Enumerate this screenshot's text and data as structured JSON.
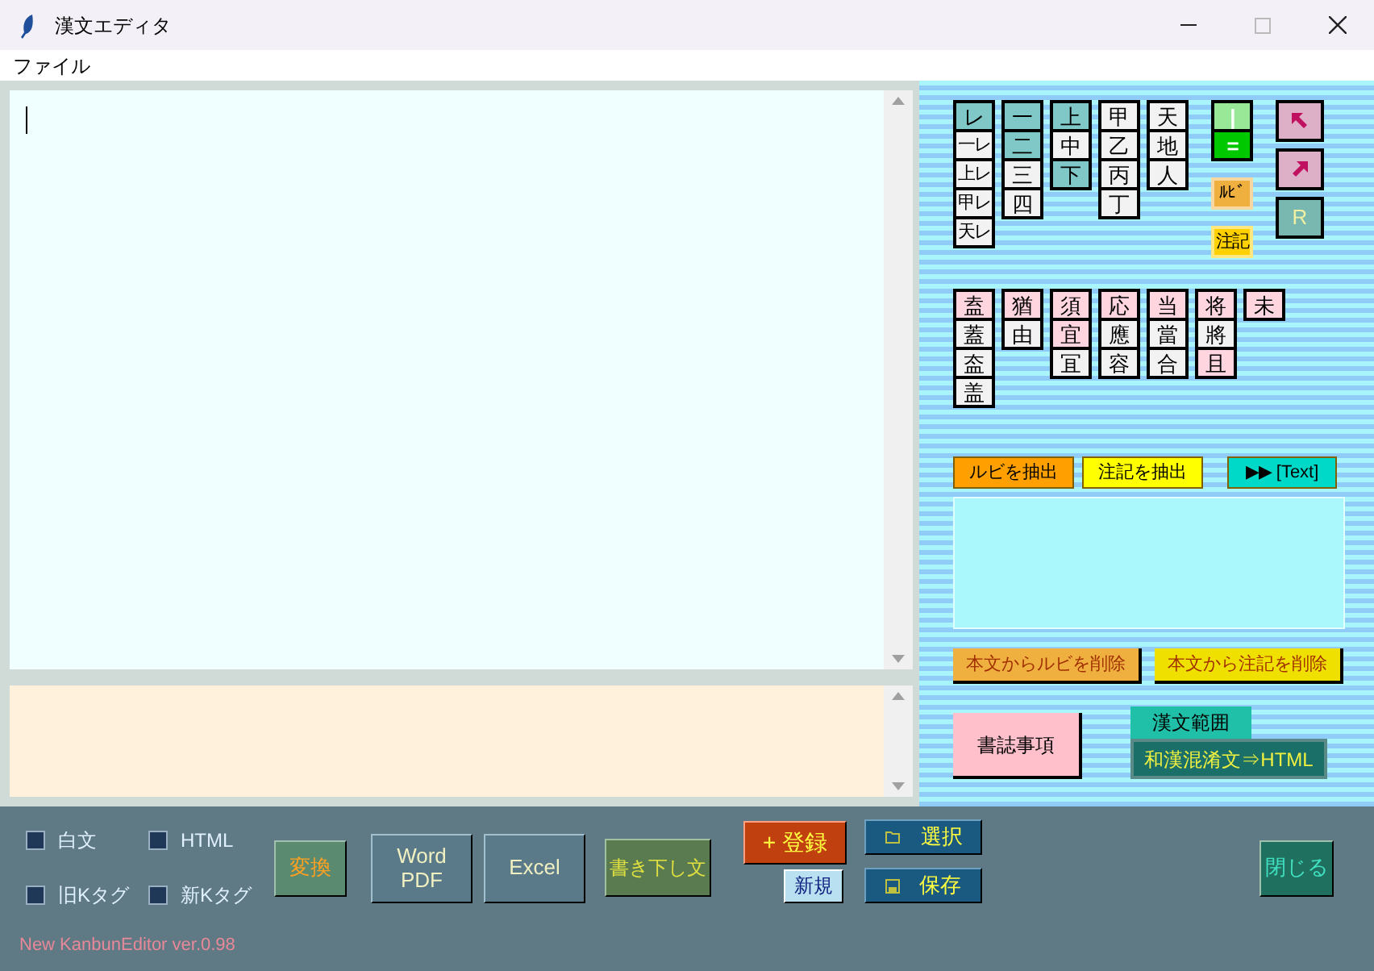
{
  "window": {
    "title": "漢文エディタ"
  },
  "menu": [
    "ファイル"
  ],
  "kanji_grid_1": [
    [
      {
        "text": "レ",
        "color": "#80c8c8"
      },
      {
        "text": "一レ",
        "color": "#f2f2f2"
      },
      {
        "text": "上レ",
        "color": "#f2f2f2"
      },
      {
        "text": "甲レ",
        "color": "#f2f2f2"
      },
      {
        "text": "天レ",
        "color": "#f2f2f2"
      }
    ],
    [
      {
        "text": "一",
        "color": "#80c8c8"
      },
      {
        "text": "二",
        "color": "#80c8c8"
      },
      {
        "text": "三",
        "color": "#f2f2f2"
      },
      {
        "text": "四",
        "color": "#f2f2f2"
      }
    ],
    [
      {
        "text": "上",
        "color": "#80c8c8"
      },
      {
        "text": "中",
        "color": "#f2f2f2"
      },
      {
        "text": "下",
        "color": "#80c8c8"
      }
    ],
    [
      {
        "text": "甲",
        "color": "#f2f2f2"
      },
      {
        "text": "乙",
        "color": "#f2f2f2"
      },
      {
        "text": "丙",
        "color": "#f2f2f2"
      },
      {
        "text": "丁",
        "color": "#f2f2f2"
      }
    ],
    [
      {
        "text": "天",
        "color": "#f2f2f2"
      },
      {
        "text": "地",
        "color": "#f2f2f2"
      },
      {
        "text": "人",
        "color": "#f2f2f2"
      }
    ]
  ],
  "mark_buttons": [
    {
      "text": "|",
      "color": "#98e898"
    },
    {
      "text": "=",
      "color": "#00c800"
    },
    {
      "text": "ﾙﾋﾞ",
      "color": "#f0b040"
    },
    {
      "text": "注記",
      "color": "#ffd000"
    }
  ],
  "arrow_buttons": [
    {
      "kind": "up-left",
      "color": "#ddb0c8"
    },
    {
      "kind": "up-right",
      "color": "#ddb0c8"
    },
    {
      "kind": "text",
      "text": "R",
      "color": "#78b8b0"
    }
  ],
  "kanji_grid_2": [
    [
      {
        "text": "盍",
        "color": "#ffd5e0"
      },
      {
        "text": "蓋",
        "color": "#f2f2f2"
      },
      {
        "text": "盇",
        "color": "#f2f2f2"
      },
      {
        "text": "盖",
        "color": "#f2f2f2"
      }
    ],
    [
      {
        "text": "猶",
        "color": "#ffd5e0"
      },
      {
        "text": "由",
        "color": "#f2f2f2"
      }
    ],
    [
      {
        "text": "須",
        "color": "#ffd5e0"
      },
      {
        "text": "宜",
        "color": "#ffd5e0"
      },
      {
        "text": "冝",
        "color": "#f2f2f2"
      }
    ],
    [
      {
        "text": "応",
        "color": "#ffd5e0"
      },
      {
        "text": "應",
        "color": "#f2f2f2"
      },
      {
        "text": "容",
        "color": "#f2f2f2"
      }
    ],
    [
      {
        "text": "当",
        "color": "#ffd5e0"
      },
      {
        "text": "當",
        "color": "#f2f2f2"
      },
      {
        "text": "合",
        "color": "#f2f2f2"
      }
    ],
    [
      {
        "text": "将",
        "color": "#ffd5e0"
      },
      {
        "text": "將",
        "color": "#f2f2f2"
      },
      {
        "text": "且",
        "color": "#ffd5e0"
      }
    ],
    [
      {
        "text": "未",
        "color": "#ffd5e0"
      }
    ]
  ],
  "extract_buttons": [
    "ルビを抽出",
    "注記を抽出",
    "▶▶ [Text]"
  ],
  "delete_buttons": [
    "本文からルビを削除",
    "本文から注記を削除"
  ],
  "bibliography_button": "書誌事項",
  "kanbun_range_label": "漢文範囲",
  "html_button": "和漢混淆文⇒HTML",
  "checkboxes": [
    {
      "label": "白文",
      "checked": false
    },
    {
      "label": "HTML",
      "checked": false
    },
    {
      "label": "旧Kタグ",
      "checked": false
    },
    {
      "label": "新Kタグ",
      "checked": false
    }
  ],
  "convert_button": "変換",
  "word_pdf_button": [
    "Word",
    "PDF"
  ],
  "excel_button": "Excel",
  "kakikudashi_button": "書き下し文",
  "register_button": "+ 登録",
  "new_button": "新規",
  "select_button": "選択",
  "save_button": "保存",
  "close_button": "閉じる",
  "version": "New KanbunEditor ver.0.98"
}
